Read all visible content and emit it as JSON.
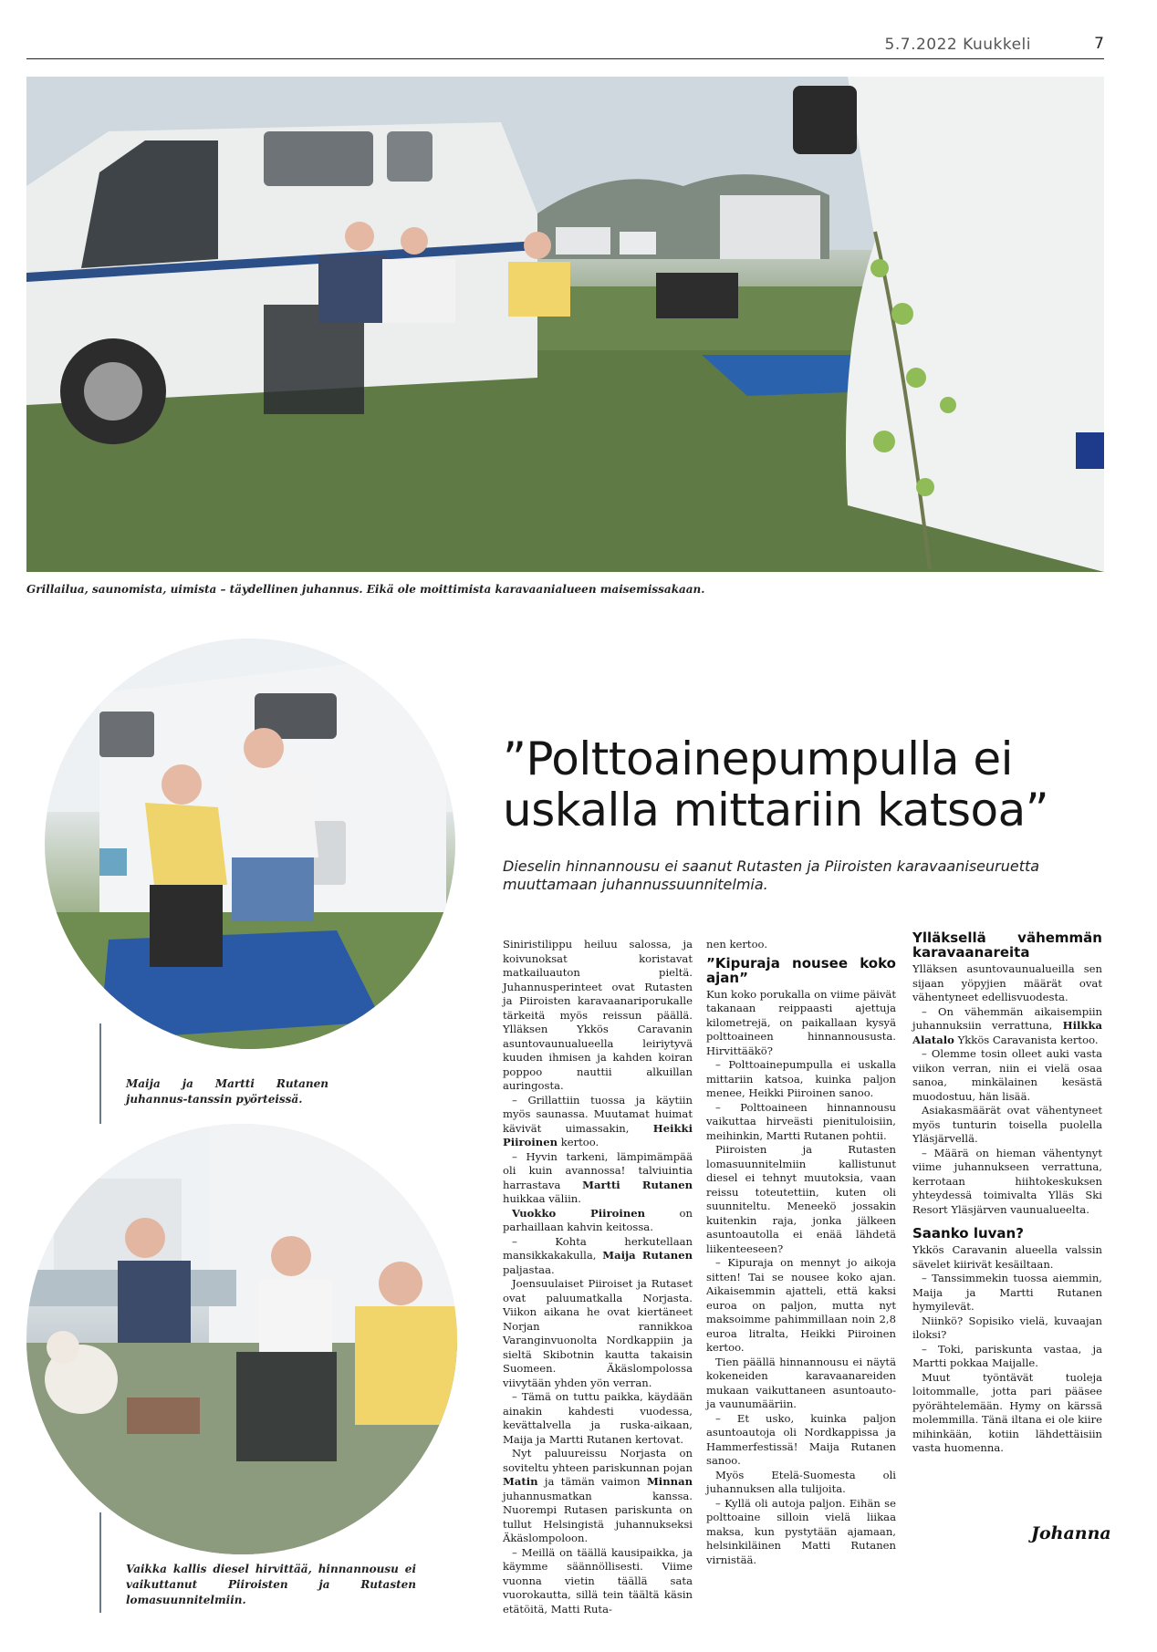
{
  "header": {
    "date": "5.7.2022 Kuukkeli",
    "page": "7"
  },
  "hero": {
    "caption": "Grillailua, saunomista, uimista – täydellinen juhannus. Eikä ole moittimista karavaanialueen maisemissakaan."
  },
  "photo1": {
    "caption": "Maija ja Martti Rutanen juhannus-tanssin pyörteissä."
  },
  "photo2": {
    "caption": "Vaikka kallis diesel hirvittää, hinnannousu ei vaikuttanut Piiroisten ja Rutasten lomasuunnitelmiin."
  },
  "article": {
    "headline": "”Polttoainepumpulla ei uskalla mittariin katsoa”",
    "lead": "Dieselin hinnannousu ei saanut Rutasten ja Piiroisten karavaaniseuruetta muuttamaan juhannussuunnitelmia.",
    "col1": [
      "Siniristilippu heiluu salossa, ja koivunoksat koristavat matkailuauton pieltä. Juhannusperinteet ovat Rutasten ja Piiroisten karavaanariporukalle tärkeitä myös reissun päällä. Ylläksen Ykkös Caravanin asuntovaunualueella leiriytyvä kuuden ihmisen ja kahden koiran poppoo nauttii alkuillan auringosta.",
      "– Grillattiin tuossa ja käytiin myös saunassa. Muutamat huimat kävivät uimassakin,",
      "Heikki Piiroinen",
      "kertoo.",
      "– Hyvin tarkeni, lämpimämpää oli kuin avannossa! talviuintia harrastava",
      "Martti Rutanen",
      "huikkaa väliin.",
      "Vuokko Piiroinen",
      "on parhaillaan kahvin keitossa.",
      "– Kohta herkutellaan mansikkakakulla,",
      "Maija Rutanen",
      "paljastaa.",
      "Joensuulaiset Piiroiset ja Rutaset ovat paluumatkalla Norjasta. Viikon aikana he ovat kiertäneet Norjan rannikkoa Varanginvuonolta Nordkappiin ja sieltä Skibotnin kautta takaisin Suomeen. Äkäslompolossa viivytään yhden yön verran.",
      "– Tämä on tuttu paikka, käydään ainakin kahdesti vuodessa, kevättalvella ja ruska-aikaan, Maija ja Martti Rutanen kertovat.",
      "Nyt paluureissu Norjasta on soviteltu yhteen pariskunnan pojan",
      "Matin",
      "ja tämän vaimon",
      "Minnan",
      "juhannusmatkan kanssa. Nuorempi Rutasen pariskunta on tullut Helsingistä juhannukseksi Äkäslompoloon.",
      "– Meillä on täällä kausipaikka, ja käymme säännöllisesti. Viime vuonna vietin täällä sata vuorokautta, sillä tein täältä käsin etätöitä, Matti Ruta-"
    ],
    "col2": {
      "intro": "nen kertoo.",
      "subhead": "”Kipuraja nousee koko ajan”",
      "paras": [
        "Kun koko porukalla on viime päivät takanaan reippaasti ajettuja kilometrejä, on paikallaan kysyä polttoaineen hinnannoususta. Hirvittääkö?",
        "– Polttoainepumpulla ei uskalla mittariin katsoa, kuinka paljon menee, Heikki Piiroinen sanoo.",
        "– Polttoaineen hinnannousu vaikuttaa hirveästi pienituloisiin, meihinkin, Martti Rutanen pohtii.",
        "Piiroisten ja Rutasten lomasuunnitelmiin kallistunut diesel ei tehnyt muutoksia, vaan reissu toteutettiin, kuten oli suunniteltu. Meneekö jossakin kuitenkin raja, jonka jälkeen asuntoautolla ei enää lähdetä liikenteeseen?",
        "– Kipuraja on mennyt jo aikoja sitten! Tai se nousee koko ajan. Aikaisemmin ajatteli, että kaksi euroa on paljon, mutta nyt maksoimme pahimmillaan noin 2,8 euroa litralta, Heikki Piiroinen kertoo.",
        "Tien päällä hinnannousu ei näytä kokeneiden karavaanareiden mukaan vaikuttaneen asuntoauto- ja vaunumääriin.",
        "– Et usko, kuinka paljon asuntoautoja oli Nordkappissa ja Hammerfestissä! Maija Rutanen sanoo.",
        "Myös Etelä-Suomesta oli juhannuksen alla tulijoita.",
        "– Kyllä oli autoja paljon. Eihän se polttoaine silloin vielä liikaa maksa, kun pystytään ajamaan, helsinkiläinen Matti Rutanen virnistää."
      ]
    },
    "col3": {
      "subhead1": "Ylläksellä vähemmän karavaanareita",
      "paras1": [
        "Ylläksen asuntovaunualueilla sen sijaan yöpyjien määrät ovat vähentyneet edellisvuodesta.",
        "– On vähemmän aikaisempiin juhannuksiin verrattuna,",
        "Hilkka Alatalo",
        "Ykkös Caravanista kertoo.",
        "– Olemme tosin olleet auki vasta viikon verran, niin ei vielä osaa sanoa, minkälainen kesästä muodostuu, hän lisää.",
        "Asiakasmäärät ovat vähentyneet myös tunturin toisella puolella Yläsjärvellä.",
        "– Määrä on hieman vähentynyt viime juhannukseen verrattuna, kerrotaan hiihtokeskuksen yhteydessä toimivalta Ylläs Ski Resort Yläsjärven vaunualueelta."
      ],
      "subhead2": "Saanko luvan?",
      "paras2": [
        "Ykkös Caravanin alueella valssin sävelet kiirivät kesäiltaan.",
        "– Tanssimmekin tuossa aiemmin, Maija ja Martti Rutanen hymyilevät.",
        "Niinkö? Sopisiko vielä, kuvaajan iloksi?",
        "– Toki, pariskunta vastaa, ja Martti pokkaa Maijalle.",
        "Muut työntävät tuoleja loitommalle, jotta pari pääsee pyörähtelemään. Hymy on kärssä molemmilla. Tänä iltana ei ole kiire mihinkään, kotiin lähdettäisiin vasta huomenna."
      ]
    },
    "signature": "Johanna"
  }
}
